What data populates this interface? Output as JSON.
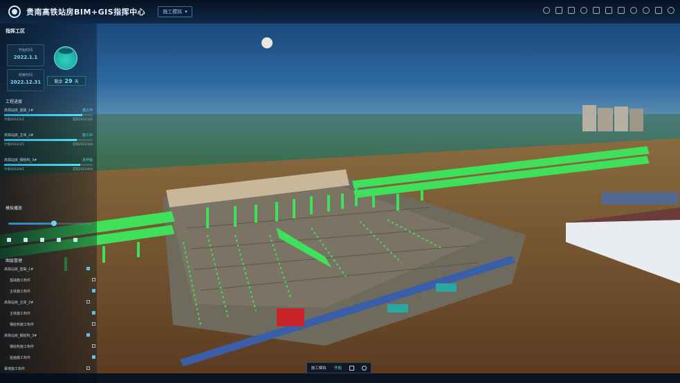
{
  "header": {
    "title": "贵南高铁站房BIM+GIS指挥中心",
    "mode_tab": "施工模拟"
  },
  "left_panel": {
    "heading": "指挥工区",
    "start_date": {
      "label": "开始时间",
      "value": "2022.1.1"
    },
    "end_date": {
      "label": "结束时间",
      "value": "2022.12.31"
    },
    "days": {
      "label": "剩余",
      "value": "29",
      "unit": "天"
    },
    "progress_fraction": 0.7,
    "work_section": {
      "title": "工程进度",
      "items": [
        {
          "name": "高铁站房_基础_1#",
          "status": "施工中",
          "plan": "计划2022/1/1",
          "actual": "实际2022/1/5",
          "progress": 0.88
        },
        {
          "name": "高铁站房_主体_2#",
          "status": "施工中",
          "plan": "计划2022/3/1",
          "actual": "实际2022/3/8",
          "progress": 0.82
        },
        {
          "name": "高铁站房_钢结构_3#",
          "status": "未开始",
          "plan": "计划2022/6/1",
          "actual": "实际2022/6/9",
          "progress": 0.86
        }
      ]
    },
    "play_section": {
      "title": "模拟播放",
      "position": 0.55
    },
    "layer_section": {
      "title": "图层管理",
      "items": [
        {
          "label": "高铁站房_基础_1#",
          "checked": true
        },
        {
          "label": "基础施工构件",
          "checked": false
        },
        {
          "label": "主体施工构件",
          "checked": true
        },
        {
          "label": "高铁站房_主体_2#",
          "checked": false
        },
        {
          "label": "主体施工构件",
          "checked": true
        },
        {
          "label": "钢结构施工构件",
          "checked": false
        },
        {
          "label": "高铁站房_钢结构_3#",
          "checked": true
        },
        {
          "label": "钢结构施工构件",
          "checked": false
        },
        {
          "label": "屋面施工构件",
          "checked": true
        },
        {
          "label": "幕墙施工构件",
          "checked": false
        }
      ]
    }
  },
  "bottom_bar": {
    "tab_1": "施工模拟",
    "tab_2": "开始"
  },
  "colors": {
    "accent": "#4fe0f3",
    "bim_model": "#3fe05a",
    "header_bg": "#06101e"
  },
  "icons": [
    "rotate-icon",
    "home-icon",
    "camera-icon",
    "clock-icon",
    "layers-icon",
    "measure-icon",
    "flag-icon",
    "compass-icon",
    "settings-icon",
    "fullscreen-icon",
    "user-icon"
  ]
}
